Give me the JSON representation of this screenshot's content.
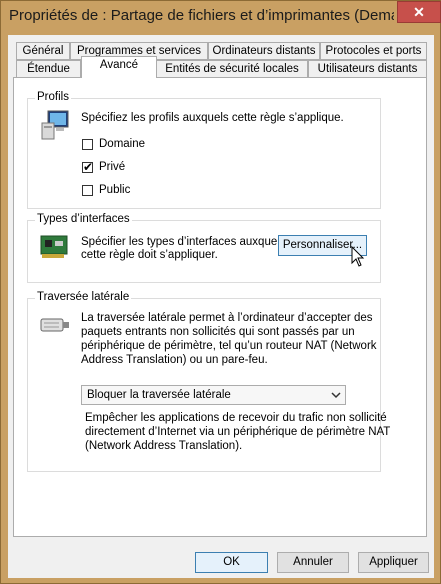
{
  "window": {
    "title": "Propriétés de : Partage de fichiers et d’imprimantes (Dema...",
    "close_glyph": "✕"
  },
  "tabs": {
    "row1": [
      "Général",
      "Programmes et services",
      "Ordinateurs distants",
      "Protocoles et ports"
    ],
    "row2": [
      "Étendue",
      "Avancé",
      "Entités de sécurité locales",
      "Utilisateurs distants"
    ],
    "active": "Avancé"
  },
  "profiles": {
    "label": "Profils",
    "description": "Spécifiez les profils auxquels cette règle s’applique.",
    "icon": "computer-icon",
    "items": [
      {
        "label": "Domaine",
        "checked": false
      },
      {
        "label": "Privé",
        "checked": true
      },
      {
        "label": "Public",
        "checked": false
      }
    ]
  },
  "interfaces": {
    "label": "Types d’interfaces",
    "description_line1": "Spécifier les types d’interfaces auxquels",
    "description_line2": "cette règle doit s’appliquer.",
    "icon": "network-card-icon",
    "customize_label": "Personnaliser..."
  },
  "edge": {
    "label": "Traversée latérale",
    "icon": "cable-connector-icon",
    "description_lines": [
      "La traversée latérale permet à l’ordinateur d’accepter des",
      "paquets entrants non sollicités qui sont passés par un",
      "périphérique de périmètre, tel qu’un routeur NAT (Network",
      "Address Translation) ou un pare-feu."
    ],
    "selected": "Bloquer la traversée latérale",
    "help_lines": [
      "Empêcher les applications de recevoir du trafic non sollicité",
      "directement d’Internet via un périphérique de périmètre NAT",
      "(Network Address Translation)."
    ]
  },
  "buttons": {
    "ok": "OK",
    "cancel": "Annuler",
    "apply": "Appliquer"
  }
}
